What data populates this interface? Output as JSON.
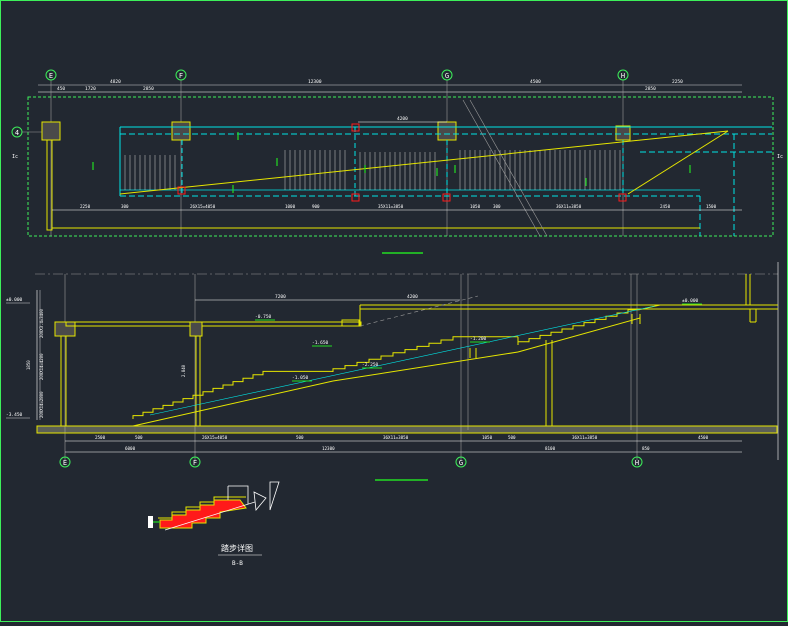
{
  "colors": {
    "background": "#222831",
    "frame": "#3df05a",
    "wall": "#e6e600",
    "aux": "#00e5e5",
    "grid": "#9a9a9a",
    "dim": "#ffffff",
    "green": "#22dd22",
    "red": "#ff1a1a",
    "hatch": "#c8c8a0"
  },
  "plan": {
    "axes": [
      "E",
      "F",
      "G",
      "H"
    ],
    "side_axis": "4",
    "top_dims": [
      "450",
      "1720",
      "2850",
      "12300",
      "4820",
      "4500",
      "2850",
      "2250"
    ],
    "bottom_dims": [
      "2250",
      "300",
      "26X15=4050",
      "1000",
      "900",
      "35X11=3850",
      "1050",
      "300",
      "36X11=3850",
      "2450",
      "1500"
    ],
    "label_4200": "4200",
    "side_labels": [
      "Ic",
      "Ic"
    ]
  },
  "section": {
    "axes": [
      "E",
      "F",
      "G",
      "H"
    ],
    "levels": [
      "±0.000",
      "-3.450"
    ],
    "marks": [
      "-0.750",
      "-1.650",
      "-2.250",
      "-1.050",
      "-1.200",
      "±0.000"
    ],
    "top_dims": [
      "7200",
      "4200"
    ],
    "left_dims": [
      "200X3.4=3400",
      "1850",
      "200X14=4200",
      "200X14=2800"
    ],
    "bottom_dims_row1": [
      "2500",
      "500",
      "26X15=4050",
      "500",
      "36X11=3850",
      "1050",
      "500",
      "36X11=3850",
      "4500"
    ],
    "bottom_dims_row2": [
      "6000",
      "12300",
      "8100",
      "850"
    ],
    "mid_label": "2.840"
  },
  "detail": {
    "caption": "踏步详图",
    "sub_caption": "B-B"
  }
}
